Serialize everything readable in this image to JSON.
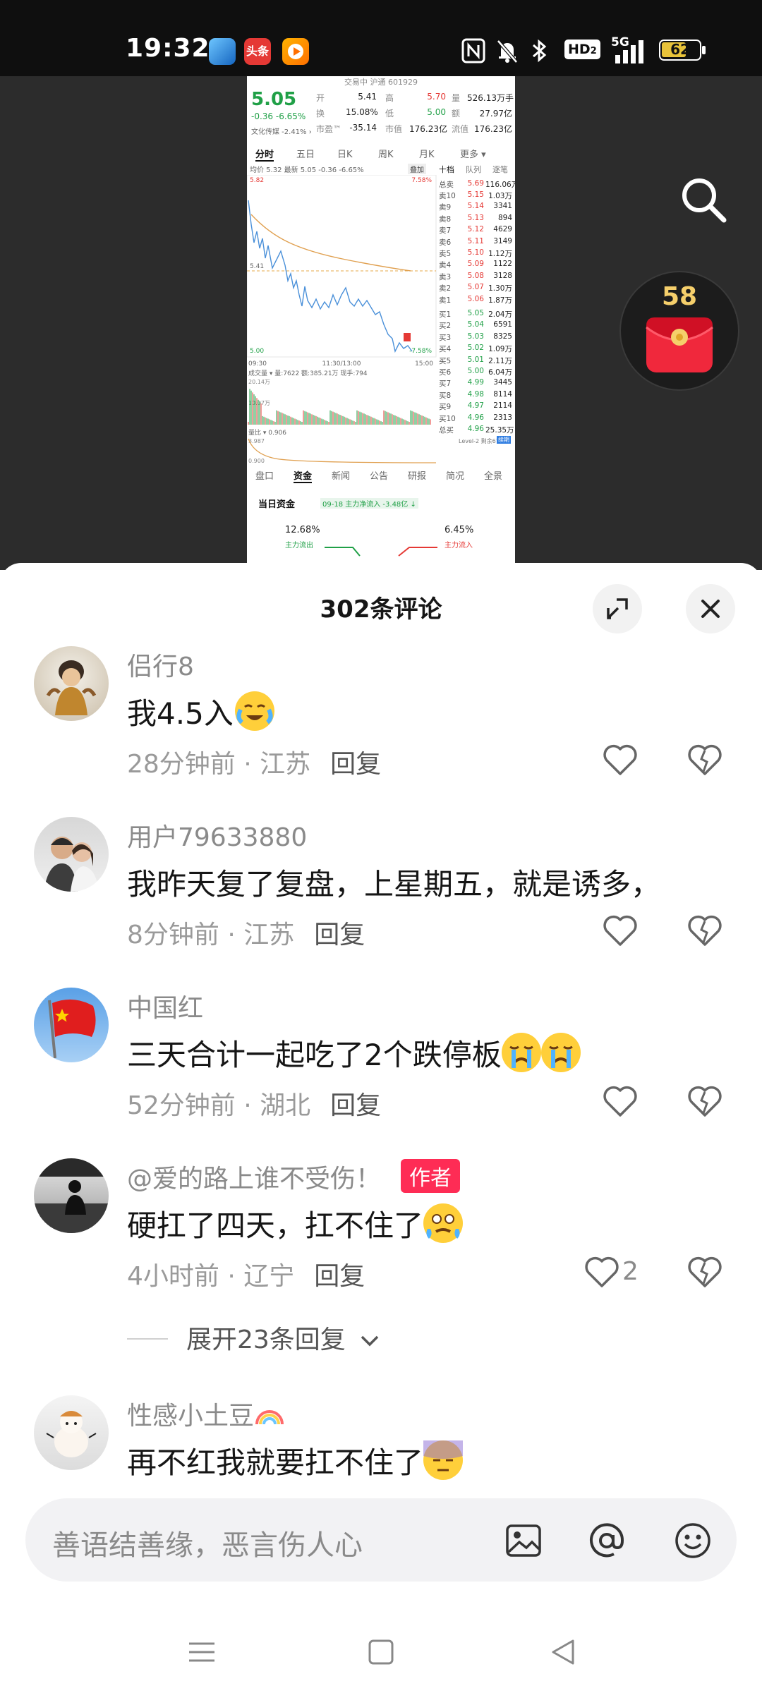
{
  "status_bar": {
    "time": "19:32",
    "app_icons": [
      "app-blue-icon",
      "toutiao-icon",
      "video-app-icon"
    ],
    "toutiao_label": "头条",
    "hd_label": "HD",
    "hd_sub": "2",
    "net_label": "5G",
    "battery": "62"
  },
  "video": {
    "stock": {
      "header": "交易中 沪通 601929",
      "price": "5.05",
      "change": "-0.36",
      "change_pct": "-6.65%",
      "sector": "文化传媒 -2.41% ›",
      "quote_rows": [
        {
          "k1": "开",
          "v1": "5.41",
          "k2": "高",
          "v2": "5.70",
          "k3": "量",
          "v3": "526.13万手"
        },
        {
          "k1": "换",
          "v1": "15.08%",
          "k2": "低",
          "v2": "5.00",
          "k3": "额",
          "v3": "27.97亿"
        },
        {
          "k1": "市盈™",
          "v1": "-35.14",
          "k2": "市值",
          "v2": "176.23亿",
          "k3": "流值",
          "v3": "176.23亿"
        }
      ],
      "tabs": [
        "分时",
        "五日",
        "日K",
        "周K",
        "月K",
        "更多 ▾"
      ],
      "avg_line": "均价 5.32  最新 5.05 -0.36 -6.65%",
      "overlay_label": "叠加",
      "order_tabs": [
        "十档",
        "队列",
        "逐笔"
      ],
      "chart_high": "5.82",
      "chart_high_pct": "7.58%",
      "chart_mid": "5.41",
      "chart_low": "5.00",
      "chart_low_pct": "-7.58%",
      "time_axis": [
        "09:30",
        "11:30/13:00",
        "15:00"
      ],
      "volume_header": "成交量 ▾  量:7622 额:385.21万 现手:794",
      "volume_ticks": [
        "20.14万",
        "10.07万"
      ],
      "ratio_header": "量比 ▾ 0.906",
      "ratio_ticks": [
        "3.987",
        "0.900"
      ],
      "total_sell": {
        "label": "总卖",
        "price": "5.69",
        "vol": "116.06万"
      },
      "sells": [
        {
          "label": "卖10",
          "price": "5.15",
          "vol": "1.03万"
        },
        {
          "label": "卖9",
          "price": "5.14",
          "vol": "3341"
        },
        {
          "label": "卖8",
          "price": "5.13",
          "vol": "894"
        },
        {
          "label": "卖7",
          "price": "5.12",
          "vol": "4629"
        },
        {
          "label": "卖6",
          "price": "5.11",
          "vol": "3149"
        },
        {
          "label": "卖5",
          "price": "5.10",
          "vol": "1.12万"
        },
        {
          "label": "卖4",
          "price": "5.09",
          "vol": "1122"
        },
        {
          "label": "卖3",
          "price": "5.08",
          "vol": "3128"
        },
        {
          "label": "卖2",
          "price": "5.07",
          "vol": "1.30万"
        },
        {
          "label": "卖1",
          "price": "5.06",
          "vol": "1.87万"
        }
      ],
      "buys": [
        {
          "label": "买1",
          "price": "5.05",
          "vol": "2.04万"
        },
        {
          "label": "买2",
          "price": "5.04",
          "vol": "6591"
        },
        {
          "label": "买3",
          "price": "5.03",
          "vol": "8325"
        },
        {
          "label": "买4",
          "price": "5.02",
          "vol": "1.09万"
        },
        {
          "label": "买5",
          "price": "5.01",
          "vol": "2.11万"
        },
        {
          "label": "买6",
          "price": "5.00",
          "vol": "6.04万"
        },
        {
          "label": "买7",
          "price": "4.99",
          "vol": "3445"
        },
        {
          "label": "买8",
          "price": "4.98",
          "vol": "8114"
        },
        {
          "label": "买9",
          "price": "4.97",
          "vol": "2114"
        },
        {
          "label": "买10",
          "price": "4.96",
          "vol": "2313"
        }
      ],
      "total_buy": {
        "label": "总买",
        "price": "4.96",
        "vol": "25.35万"
      },
      "level2_note": "Level-2 剩余67天",
      "level2_badge": "续期",
      "bottom_tabs": [
        "盘口",
        "资金",
        "新闻",
        "公告",
        "研报",
        "简况",
        "全景"
      ],
      "funds_title": "当日资金",
      "funds_tag": "09-18 主力净流入 -3.48亿 ↓",
      "outflow_pct": "12.68%",
      "outflow_label": "主力流出",
      "inflow_pct": "6.45%",
      "inflow_label": "主力流入"
    },
    "redpacket_count": "58"
  },
  "comments_panel": {
    "title": "302条评论",
    "input_placeholder": "善语结善缘，恶言伤人心",
    "expand_label": "展开23条回复",
    "reply_label": "回复",
    "author_label": "作者",
    "comments": [
      {
        "user": "侣行8",
        "text": "我4.5入",
        "time": "28分钟前 · 江苏",
        "likes": ""
      },
      {
        "user": "用户79633880",
        "text": "我昨天复了复盘，上星期五，就是诱多，",
        "time": "8分钟前 · 江苏",
        "likes": ""
      },
      {
        "user": "中国红",
        "text": "三天合计一起吃了2个跌停板",
        "time": "52分钟前 · 湖北",
        "likes": ""
      },
      {
        "user": "@爱的路上谁不受伤！",
        "text": "硬扛了四天，扛不住了",
        "time": "4小时前 · 辽宁",
        "likes": "2"
      },
      {
        "user": "性感小土豆",
        "text": "再不红我就要扛不住了",
        "time": "",
        "likes": ""
      }
    ]
  },
  "colors": {
    "accent_red": "#fe2c55",
    "stock_green": "#20a047",
    "stock_red": "#e53935",
    "line_blue": "#4a90d9",
    "avg_orange": "#e0a050"
  }
}
